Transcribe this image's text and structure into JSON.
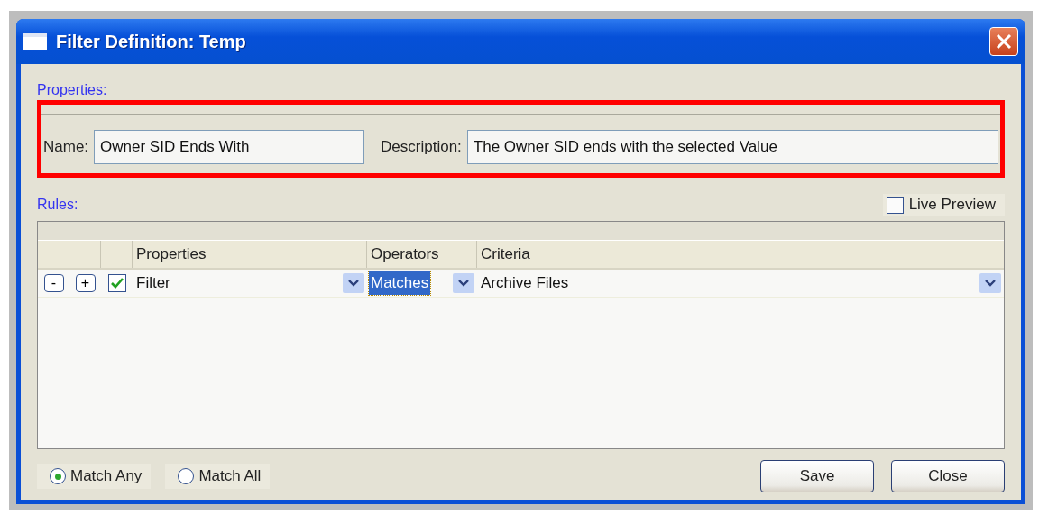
{
  "window": {
    "title": "Filter Definition: Temp"
  },
  "properties": {
    "label": "Properties:",
    "name": {
      "label": "Name:",
      "value": "Owner SID Ends With"
    },
    "description": {
      "label": "Description:",
      "value": "The Owner SID ends with the selected Value"
    }
  },
  "rules": {
    "label": "Rules:",
    "live_preview": {
      "label": "Live Preview",
      "checked": false
    },
    "columns": [
      "Properties",
      "Operators",
      "Criteria"
    ],
    "rows": [
      {
        "remove": "-",
        "add": "+",
        "enabled": true,
        "property": "Filter",
        "operator": "Matches",
        "operator_selected": true,
        "criteria": "Archive Files"
      }
    ]
  },
  "match": [
    {
      "label": "Match Any",
      "selected": true
    },
    {
      "label": "Match All",
      "selected": false
    }
  ],
  "buttons": [
    "Save",
    "Close"
  ]
}
